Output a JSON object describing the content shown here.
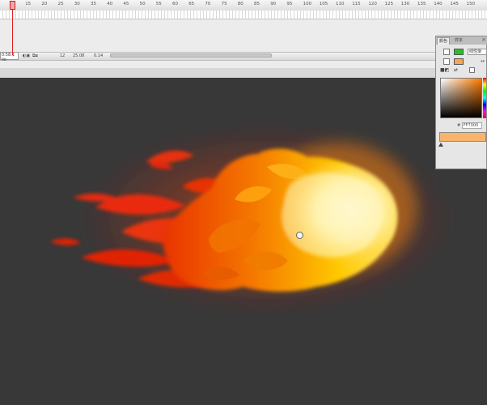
{
  "timeline": {
    "ruler_numbers": [
      "10",
      "15",
      "20",
      "25",
      "30",
      "35",
      "40",
      "45",
      "50",
      "55",
      "60",
      "65",
      "70",
      "75",
      "80",
      "85",
      "90",
      "95",
      "100",
      "105",
      "110",
      "115",
      "120",
      "125",
      "130",
      "135",
      "140",
      "145",
      "150"
    ],
    "time_readout": "0.58.1 ilo",
    "fps": "12",
    "elapsed": "25.08",
    "frame_counter": "0.14"
  },
  "color_panel": {
    "tab_color": "颜色",
    "tab_swatches": "样本",
    "close": "×",
    "type_value": "线性渐",
    "hex_label": "#",
    "hex_value": "FF7000",
    "stroke_color": "#22c322",
    "fill_color": "#f6a64e"
  },
  "icons": [
    "pencil-icon",
    "bucket-icon",
    "swap-colors-icon",
    "cursor-icon"
  ]
}
